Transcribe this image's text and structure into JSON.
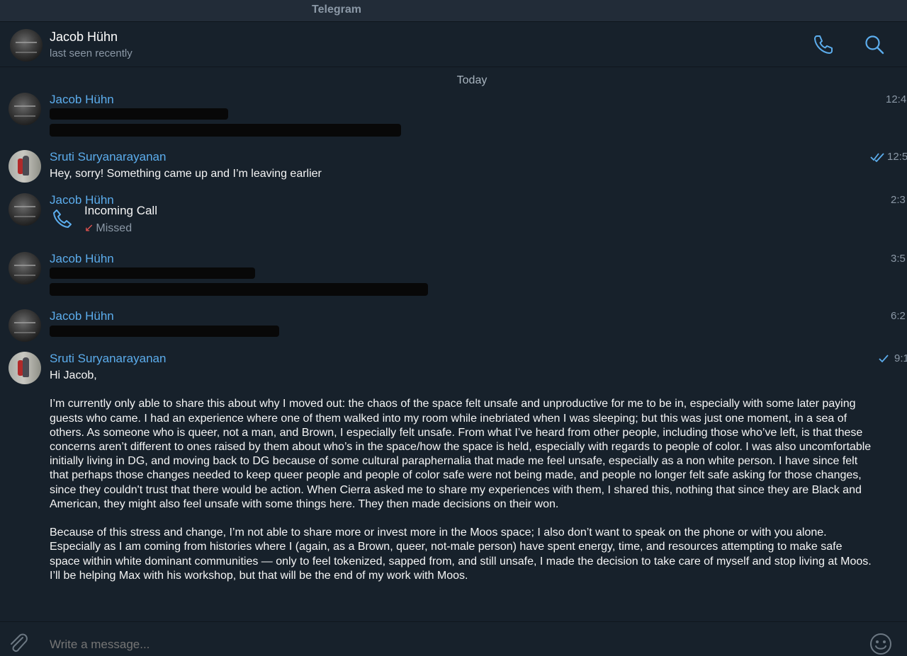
{
  "window": {
    "title": "Telegram"
  },
  "header": {
    "name": "Jacob Hühn",
    "status": "last seen recently",
    "call_icon": "phone-icon",
    "search_icon": "search-icon"
  },
  "day_separator": "Today",
  "messages": [
    {
      "author": "Jacob Hühn",
      "time": "12:4",
      "content": "redacted"
    },
    {
      "author": "Sruti Suryanarayanan",
      "time": "12:5",
      "read": "double-check",
      "text": "Hey, sorry! Something came up and I’m leaving earlier"
    },
    {
      "author": "Jacob Hühn",
      "time": "2:3",
      "call_title": "Incoming Call",
      "call_status": "Missed",
      "call_arrow": "↙"
    },
    {
      "author": "Jacob Hühn",
      "time": "3:5",
      "content": "redacted"
    },
    {
      "author": "Jacob Hühn",
      "time": "6:2",
      "content": "redacted"
    },
    {
      "author": "Sruti Suryanarayanan",
      "time": "9:1",
      "read": "single-check",
      "paragraphs": [
        "Hi Jacob,",
        "I’m currently only able to share this about why I moved out: the chaos of the space felt unsafe and unproductive for me to be in, especially with some later paying guests who came. I had an experience where one of them walked into my room while inebriated when I was sleeping; but this was just one moment, in a sea of others. As someone who is queer, not a man, and Brown, I especially felt unsafe. From what I’ve heard from other people, including those who’ve left, is that these concerns aren’t different to ones raised by them about who’s in the space/how the space is held, especially with regards to people of color. I was also uncomfortable initially living in DG, and moving back to DG because of some cultural paraphernalia that made me feel unsafe, especially as a non white person. I have since felt that perhaps those changes needed to keep queer people and people of color safe were not being made, and people no longer felt safe asking for those changes, since they couldn't trust that there would be action. When Cierra asked me to share my experiences with them, I shared this, nothing that since they are Black and American, they might also feel unsafe with some things here. They then made decisions on their won.",
        "Because of this stress and change, I’m not able to share more or invest more in the Moos space; I also don’t want to speak on the phone or with you alone. Especially as I am coming from histories where I (again, as a Brown, queer, not-male person) have spent energy, time, and resources attempting to make safe space within white dominant communities — only to feel tokenized, sapped from, and still unsafe, I made the decision to take care of myself and stop living at Moos. I’ll be helping Max with his workshop, but that will be the end of my work with Moos."
      ]
    }
  ],
  "composer": {
    "placeholder": "Write a message...",
    "attach_icon": "paperclip-icon",
    "emoji_icon": "emoji-icon"
  },
  "colors": {
    "background": "#17212b",
    "accent": "#5caded",
    "muted": "#8b98a6",
    "missed": "#e0524f"
  }
}
